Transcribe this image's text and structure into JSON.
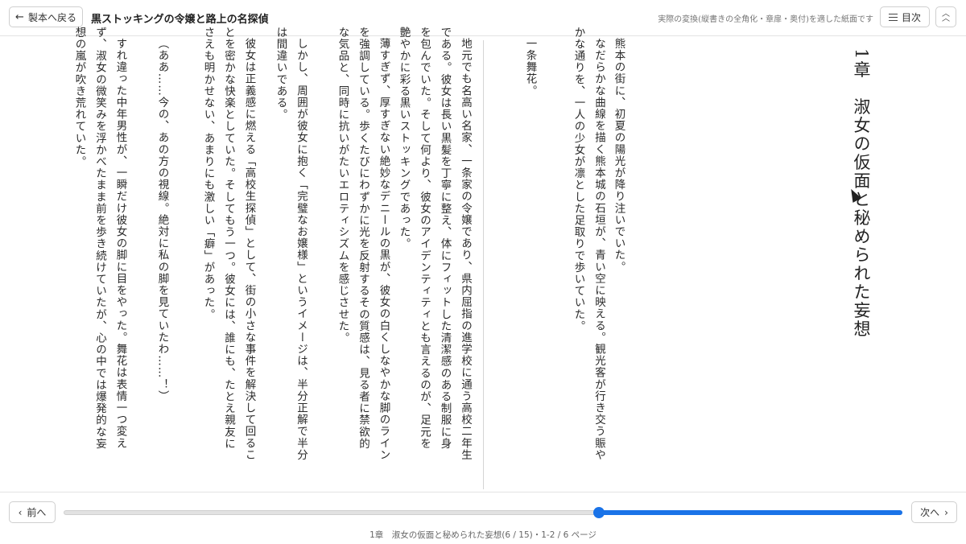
{
  "header": {
    "back_label": "製本へ戻る",
    "book_title": "黒ストッキングの令嬢と路上の名探偵",
    "paper_note": "実際の変換(縦書きの全角化・章扉・奥付)を適した紙面です",
    "toc_label": "目次",
    "collapse_icon": "double-chevron-up-icon"
  },
  "right_page": {
    "chapter_heading": "1章　淑女の仮面と秘められた妄想",
    "paragraphs": [
      "熊本の街に、初夏の陽光が降り注いでいた。",
      "なだらかな曲線を描く熊本城の石垣が、青い空に映える。観光客が行き交う賑やかな通りを、一人の少女が凛とした足取りで歩いていた。",
      "一条舞花。"
    ]
  },
  "left_page": {
    "paragraphs": [
      "地元でも名高い名家、一条家の令嬢であり、県内屈指の進学校に通う高校二年生である。彼女は長い黒髪を丁寧に整え、体にフィットした清潔感のある制服に身を包んでいた。そして何より、彼女のアイデンティティとも言えるのが、足元を艶やかに彩る黒いストッキングであった。",
      "薄すぎず、厚すぎない絶妙なデニールの黒が、彼女の白くしなやかな脚のラインを強調している。歩くたびにわずかに光を反射するその質感は、見る者に禁欲的な気品と、同時に抗いがたいエロティシズムを感じさせた。",
      "しかし、周囲が彼女に抱く「完璧なお嬢様」というイメージは、半分正解で半分は間違いである。",
      "彼女は正義感に燃える「高校生探偵」として、街の小さな事件を解決して回ることを密かな快楽としていた。そしてもう一つ。彼女には、誰にも、たとえ親友にさえも明かせない、あまりにも激しい「癖」があった。",
      "（ああ……今の、あの方の視線。絶対に私の脚を見ていたわ……！）",
      "すれ違った中年男性が、一瞬だけ彼女の脚に目をやった。舞花は表情一つ変えず、淑女の微笑みを浮かべたまま前を歩き続けていたが、心の中では爆発的な妄想の嵐が吹き荒れていた。"
    ]
  },
  "footer": {
    "prev_label": "前へ",
    "next_label": "次へ",
    "progress": 0.64,
    "status": "1章　淑女の仮面と秘められた妄想(6 / 15)・1-2 / 6 ページ"
  },
  "colors": {
    "accent": "#1a73e8",
    "divider": "#d4d4d4"
  }
}
